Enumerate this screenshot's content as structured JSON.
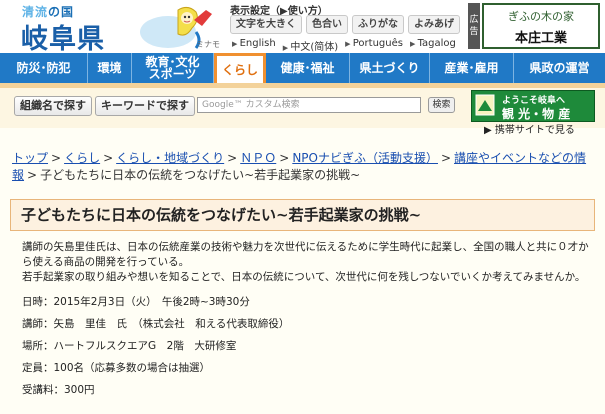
{
  "header": {
    "tagline_accent": "清流",
    "tagline_rest": "の国",
    "logo_text": "岐阜県",
    "mascot_caption": "ミナモ",
    "display_settings_label": "表示設定（▶使い方）",
    "display_buttons": [
      "文字を大きく",
      "色合い",
      "ふりがな",
      "よみあげ"
    ],
    "languages": [
      "English",
      "中文(简体)",
      "Português",
      "Tagalog"
    ],
    "ad_label": "広告",
    "ad_line1": "ぎふの木の家",
    "ad_line2": "本庄工業"
  },
  "nav": {
    "items": [
      "防災･防犯",
      "環境",
      "教育･文化\nスポーツ",
      "くらし",
      "健康･福祉",
      "県土づくり",
      "産業･雇用",
      "県政の運営"
    ]
  },
  "search": {
    "org_search_label": "組織名で探す",
    "keyword_search_label": "キーワードで探す",
    "placeholder": "Google™ カスタム検索",
    "search_button": "検索",
    "welcome_line1": "ようこそ岐阜へ",
    "welcome_line2": "観 光・物 産",
    "mobile_link": "▶ 携帯サイトで見る"
  },
  "breadcrumb": {
    "links": [
      "トップ",
      "くらし",
      "くらし・地域づくり",
      "ＮＰＯ",
      "NPOナビぎふ（活動支援）",
      "講座やイベントなどの情報"
    ],
    "current": "子どもたちに日本の伝統をつなげたい~若手起業家の挑戦~"
  },
  "page_title": "子どもたちに日本の伝統をつなげたい~若手起業家の挑戦~",
  "article": {
    "intro1": "講師の矢島里佳氏は、日本の伝統産業の技術や魅力を次世代に伝えるために学生時代に起業し、全国の職人と共に０才から使える商品の開発を行っている。",
    "intro2": "若手起業家の取り組みや想いを知ることで、日本の伝統について、次世代に何を残しつないでいくか考えてみませんか。",
    "date": "日時：2015年2月3日（火）　午後2時~3時30分",
    "lecturer": "講師：矢島　里佳　氏　（株式会社　和える代表取締役）",
    "venue": "場所：ハートフルスクエアG　2階　大研修室",
    "capacity": "定員：100名（応募多数の場合は抽選）",
    "fee": "受講料：300円"
  },
  "colors": {
    "nav_blue": "#2079c6",
    "nav_active_border": "#f09030",
    "link_blue": "#1a4fb0",
    "title_bg": "#fdf1e0",
    "welcome_green": "#1e8a3a"
  }
}
